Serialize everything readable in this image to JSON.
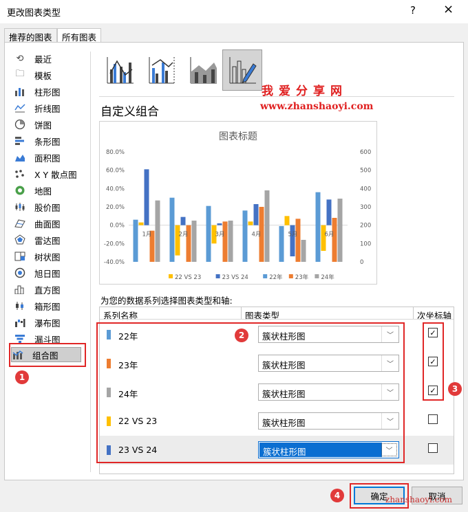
{
  "dialog": {
    "title": "更改图表类型",
    "help": "?",
    "close": "×"
  },
  "tabs": [
    {
      "label": "推荐的图表"
    },
    {
      "label": "所有图表"
    }
  ],
  "sidebar": {
    "items": [
      {
        "label": "最近",
        "icon": "recent-icon"
      },
      {
        "label": "模板",
        "icon": "template-icon"
      },
      {
        "label": "柱形图",
        "icon": "column-chart-icon"
      },
      {
        "label": "折线图",
        "icon": "line-chart-icon"
      },
      {
        "label": "饼图",
        "icon": "pie-chart-icon"
      },
      {
        "label": "条形图",
        "icon": "bar-chart-icon"
      },
      {
        "label": "面积图",
        "icon": "area-chart-icon"
      },
      {
        "label": "X Y 散点图",
        "icon": "scatter-chart-icon"
      },
      {
        "label": "地图",
        "icon": "map-chart-icon"
      },
      {
        "label": "股价图",
        "icon": "stock-chart-icon"
      },
      {
        "label": "曲面图",
        "icon": "surface-chart-icon"
      },
      {
        "label": "雷达图",
        "icon": "radar-chart-icon"
      },
      {
        "label": "树状图",
        "icon": "treemap-icon"
      },
      {
        "label": "旭日图",
        "icon": "sunburst-icon"
      },
      {
        "label": "直方图",
        "icon": "histogram-icon"
      },
      {
        "label": "箱形图",
        "icon": "box-whisker-icon"
      },
      {
        "label": "瀑布图",
        "icon": "waterfall-icon"
      },
      {
        "label": "漏斗图",
        "icon": "funnel-icon"
      },
      {
        "label": "组合图",
        "icon": "combo-chart-icon",
        "selected": true
      }
    ]
  },
  "main": {
    "heading": "自定义组合",
    "watermark_cn": "我爱分享网",
    "watermark_url": "www.zhanshaoyi.com",
    "series_caption": "为您的数据系列选择图表类型和轴:",
    "columns": {
      "name": "系列名称",
      "type": "图表类型",
      "secondary": "次坐标轴"
    },
    "rows": [
      {
        "name": "22年",
        "color": "#5b9bd5",
        "type": "簇状柱形图",
        "secondary": true
      },
      {
        "name": "23年",
        "color": "#ed7d31",
        "type": "簇状柱形图",
        "secondary": true
      },
      {
        "name": "24年",
        "color": "#a5a5a5",
        "type": "簇状柱形图",
        "secondary": true
      },
      {
        "name": "22 VS 23",
        "color": "#ffc000",
        "type": "簇状柱形图",
        "secondary": false
      },
      {
        "name": "23 VS 24",
        "color": "#4472c4",
        "type": "簇状柱形图",
        "secondary": false,
        "selected": true
      }
    ],
    "check_mark": "✓",
    "dropdown_arrow": "﹀"
  },
  "badges": [
    "1",
    "2",
    "3",
    "4"
  ],
  "buttons": {
    "ok": "确定",
    "cancel": "取消"
  },
  "footer_watermark": "zhanshaoyi.com",
  "chart_data": {
    "type": "bar",
    "title": "图表标题",
    "categories": [
      "1月",
      "2月",
      "3月",
      "4月",
      "5月",
      "6月"
    ],
    "primary_axis_ticks": [
      "80.0%",
      "60.0%",
      "40.0%",
      "20.0%",
      "0.0%",
      "-20.0%",
      "-40.0%"
    ],
    "secondary_axis_ticks": [
      "600",
      "500",
      "400",
      "300",
      "200",
      "100",
      "0"
    ],
    "ylim_primary": [
      -0.4,
      0.8
    ],
    "ylim_secondary": [
      0,
      600
    ],
    "series": [
      {
        "name": "22 VS 23",
        "axis": "primary",
        "color": "#ffc000",
        "values": [
          0.03,
          -0.33,
          -0.2,
          0.04,
          0.1,
          -0.28
        ]
      },
      {
        "name": "23 VS 24",
        "axis": "primary",
        "color": "#4472c4",
        "values": [
          0.61,
          0.09,
          0.02,
          0.23,
          -0.34,
          0.28
        ]
      },
      {
        "name": "22年",
        "axis": "secondary",
        "color": "#5b9bd5",
        "values": [
          230,
          350,
          305,
          280,
          195,
          380
        ]
      },
      {
        "name": "23年",
        "axis": "secondary",
        "color": "#ed7d31",
        "values": [
          170,
          200,
          220,
          300,
          235,
          240
        ]
      },
      {
        "name": "24年",
        "axis": "secondary",
        "color": "#a5a5a5",
        "values": [
          335,
          225,
          225,
          390,
          120,
          345
        ]
      }
    ],
    "legend": "bottom",
    "grid": true
  }
}
